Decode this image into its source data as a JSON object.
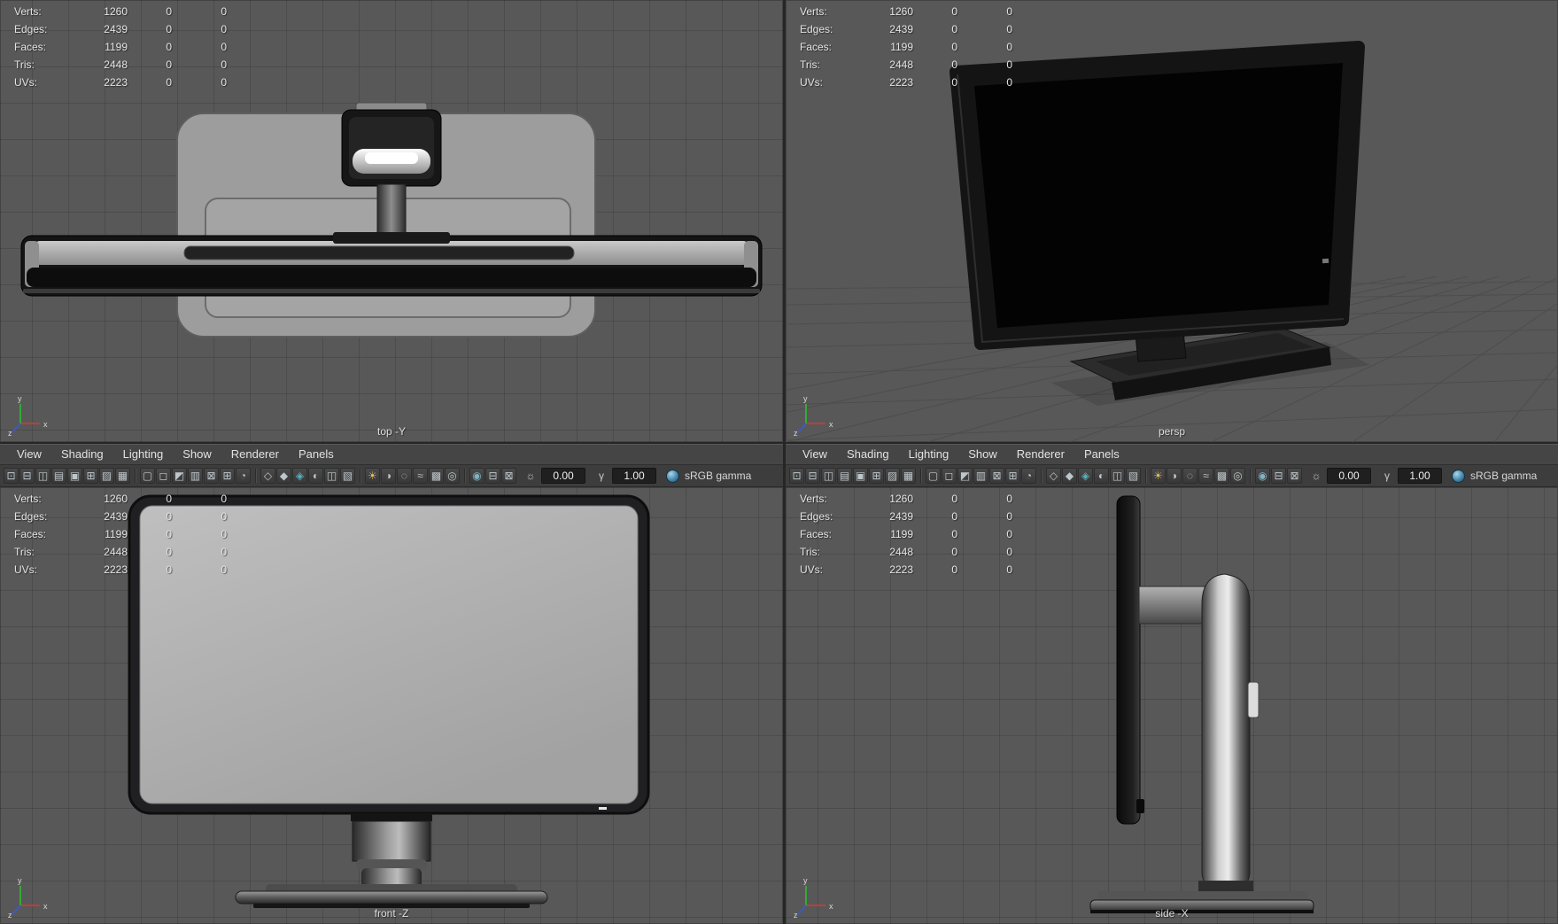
{
  "stats": {
    "rows": [
      {
        "label": "Verts:",
        "v1": "1260",
        "v2": "0",
        "v3": "0"
      },
      {
        "label": "Edges:",
        "v1": "2439",
        "v2": "0",
        "v3": "0"
      },
      {
        "label": "Faces:",
        "v1": "1199",
        "v2": "0",
        "v3": "0"
      },
      {
        "label": "Tris:",
        "v1": "2448",
        "v2": "0",
        "v3": "0"
      },
      {
        "label": "UVs:",
        "v1": "2223",
        "v2": "0",
        "v3": "0"
      }
    ]
  },
  "viewports": {
    "top": {
      "label": "top -Y"
    },
    "persp": {
      "label": "persp"
    },
    "front": {
      "label": "front -Z"
    },
    "side": {
      "label": "side -X"
    }
  },
  "axis": {
    "x": "x",
    "y": "y",
    "z": "z"
  },
  "menu": {
    "items": [
      {
        "name": "menu-view",
        "label": "View"
      },
      {
        "name": "menu-shading",
        "label": "Shading"
      },
      {
        "name": "menu-lighting",
        "label": "Lighting"
      },
      {
        "name": "menu-show",
        "label": "Show"
      },
      {
        "name": "menu-renderer",
        "label": "Renderer"
      },
      {
        "name": "menu-panels",
        "label": "Panels"
      }
    ]
  },
  "toolbar": {
    "groups": {
      "view_tools": [
        {
          "name": "select-camera-icon",
          "glyph": "⊡"
        },
        {
          "name": "lock-camera-icon",
          "glyph": "⊟"
        },
        {
          "name": "camera-attributes-icon",
          "glyph": "◫"
        },
        {
          "name": "bookmarks-icon",
          "glyph": "▤"
        },
        {
          "name": "image-plane-icon",
          "glyph": "▣"
        },
        {
          "name": "2d-pan-zoom-icon",
          "glyph": "⊞"
        },
        {
          "name": "grease-pencil-icon",
          "glyph": "▨"
        },
        {
          "name": "grid-toggle-icon",
          "glyph": "▦"
        }
      ],
      "gates": [
        {
          "name": "film-gate-icon",
          "glyph": "▢"
        },
        {
          "name": "resolution-gate-icon",
          "glyph": "◻"
        },
        {
          "name": "gate-mask-icon",
          "glyph": "◩"
        },
        {
          "name": "field-chart-icon",
          "glyph": "▥"
        },
        {
          "name": "safe-action-icon",
          "glyph": "⊠"
        },
        {
          "name": "safe-title-icon",
          "glyph": "⊞"
        },
        {
          "name": "frame-rate-icon",
          "glyph": "◔"
        }
      ],
      "shading": [
        {
          "name": "wireframe-icon",
          "glyph": "◇"
        },
        {
          "name": "shaded-icon",
          "glyph": "◆"
        },
        {
          "name": "textured-icon",
          "glyph": "◈",
          "color": "#4fb6c6"
        },
        {
          "name": "use-default-material-icon",
          "glyph": "◐"
        },
        {
          "name": "wireframe-on-shaded-icon",
          "glyph": "◫"
        },
        {
          "name": "xray-icon",
          "glyph": "▧"
        }
      ],
      "lighting": [
        {
          "name": "use-all-lights-icon",
          "glyph": "☀",
          "color": "#d9bd62"
        },
        {
          "name": "shadows-icon",
          "glyph": "◑"
        },
        {
          "name": "ambient-occlusion-icon",
          "glyph": "◌"
        },
        {
          "name": "motion-blur-icon",
          "glyph": "≈"
        },
        {
          "name": "anti-aliasing-icon",
          "glyph": "▩"
        },
        {
          "name": "depth-of-field-icon",
          "glyph": "◎"
        }
      ],
      "misc": [
        {
          "name": "isolate-select-icon",
          "glyph": "◉",
          "color": "#7fb2c4"
        },
        {
          "name": "split-view-icon",
          "glyph": "⊟"
        },
        {
          "name": "snapshot-icon",
          "glyph": "⊠"
        }
      ]
    },
    "exposure": {
      "icon_glyph": "☼",
      "value": "0.00"
    },
    "gamma": {
      "icon_glyph": "γ",
      "value": "1.00"
    },
    "color_transform_label": "sRGB gamma"
  },
  "colors": {
    "viewport_bg": "#585858",
    "grid_line": "#4b4b4b",
    "menubar_bg": "#454545",
    "toolbar_bg": "#3d3d3d",
    "screen_black": "#030303",
    "accent_teal": "#4fb6c6"
  }
}
